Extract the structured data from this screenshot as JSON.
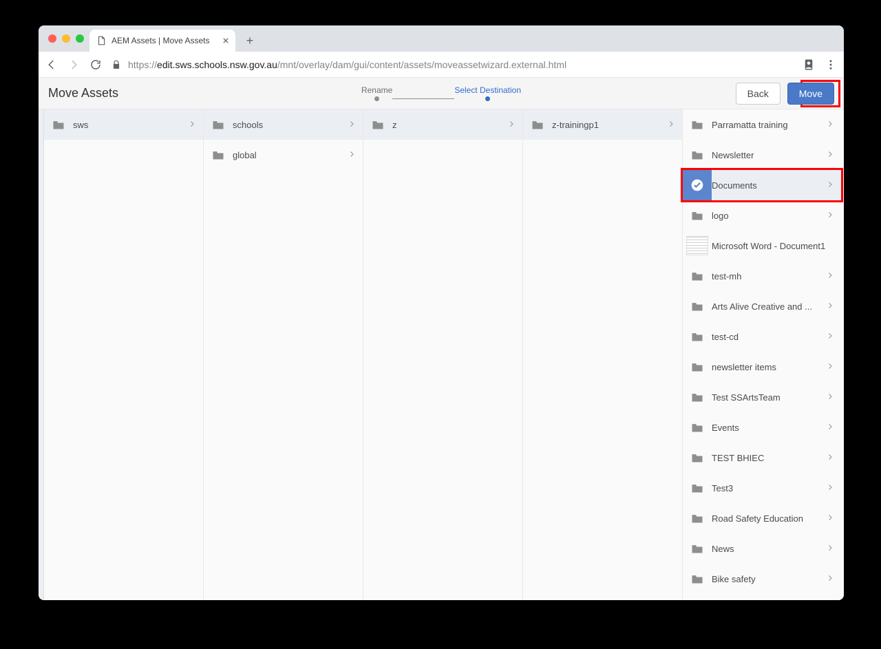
{
  "browser": {
    "tab_title": "AEM Assets | Move Assets",
    "url_host": "edit.sws.schools.nsw.gov.au",
    "url_path": "/mnt/overlay/dam/gui/content/assets/moveassetwizard.external.html",
    "url_scheme": "https://"
  },
  "header": {
    "title": "Move Assets",
    "step1": "Rename",
    "step2": "Select Destination",
    "back_label": "Back",
    "move_label": "Move"
  },
  "columns": [
    {
      "items": [
        {
          "label": "sws",
          "type": "folder",
          "state": "path"
        }
      ]
    },
    {
      "items": [
        {
          "label": "schools",
          "type": "folder",
          "state": "path"
        },
        {
          "label": "global",
          "type": "folder",
          "state": "none"
        }
      ]
    },
    {
      "items": [
        {
          "label": "z",
          "type": "folder",
          "state": "path"
        }
      ]
    },
    {
      "items": [
        {
          "label": "z-trainingp1",
          "type": "folder",
          "state": "path"
        }
      ]
    },
    {
      "items": [
        {
          "label": "Parramatta training",
          "type": "folder",
          "state": "none"
        },
        {
          "label": "Newsletter",
          "type": "folder",
          "state": "none"
        },
        {
          "label": "Documents",
          "type": "folder",
          "state": "selected"
        },
        {
          "label": "logo",
          "type": "folder",
          "state": "none"
        },
        {
          "label": "Microsoft Word - Document1",
          "type": "doc",
          "state": "none",
          "no_chevron": true
        },
        {
          "label": "test-mh",
          "type": "folder",
          "state": "none"
        },
        {
          "label": "Arts Alive Creative and ...",
          "type": "folder",
          "state": "none"
        },
        {
          "label": "test-cd",
          "type": "folder",
          "state": "none"
        },
        {
          "label": "newsletter items",
          "type": "folder",
          "state": "none"
        },
        {
          "label": "Test SSArtsTeam",
          "type": "folder",
          "state": "none"
        },
        {
          "label": "Events",
          "type": "folder",
          "state": "none"
        },
        {
          "label": "TEST BHIEC",
          "type": "folder",
          "state": "none"
        },
        {
          "label": "Test3",
          "type": "folder",
          "state": "none"
        },
        {
          "label": "Road Safety Education",
          "type": "folder",
          "state": "none"
        },
        {
          "label": "News",
          "type": "folder",
          "state": "none"
        },
        {
          "label": "Bike safety",
          "type": "folder",
          "state": "none"
        }
      ]
    }
  ]
}
